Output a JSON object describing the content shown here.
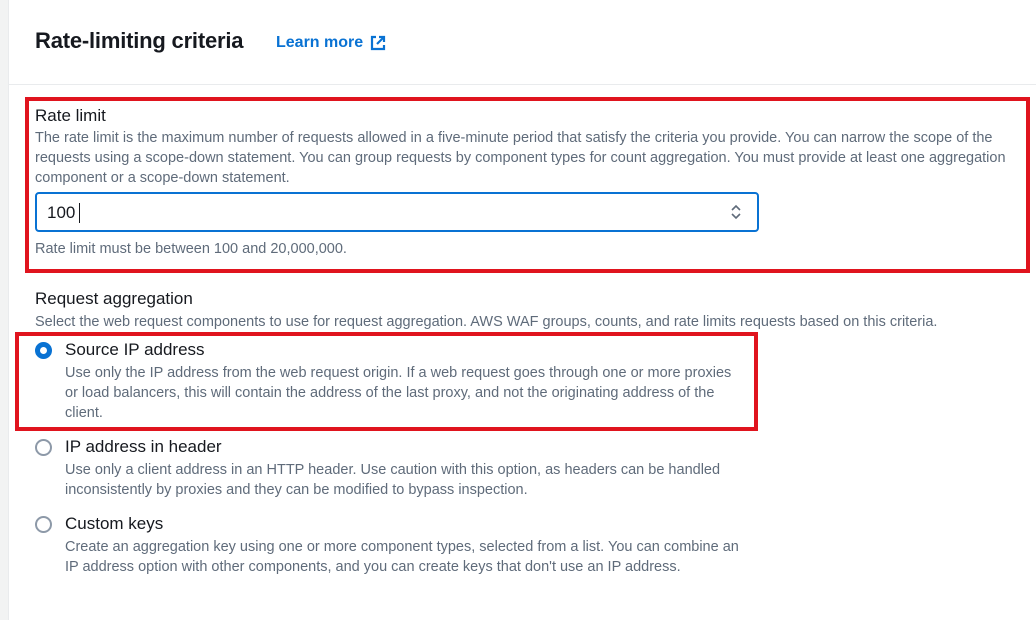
{
  "section": {
    "title": "Rate-limiting criteria",
    "learn_more": "Learn more"
  },
  "rate_limit": {
    "label": "Rate limit",
    "description": "The rate limit is the maximum number of requests allowed in a five-minute period that satisfy the criteria you provide. You can narrow the scope of the requests using a scope-down statement. You can group requests by component types for count aggregation. You must provide at least one aggregation component or a scope-down statement.",
    "value": "100",
    "constraint": "Rate limit must be between 100 and 20,000,000."
  },
  "aggregation": {
    "label": "Request aggregation",
    "description": "Select the web request components to use for request aggregation. AWS WAF groups, counts, and rate limits requests based on this criteria.",
    "options": [
      {
        "title": "Source IP address",
        "description": "Use only the IP address from the web request origin. If a web request goes through one or more proxies or load balancers, this will contain the address of the last proxy, and not the originating address of the client.",
        "selected": true
      },
      {
        "title": "IP address in header",
        "description": "Use only a client address in an HTTP header. Use caution with this option, as headers can be handled inconsistently by proxies and they can be modified to bypass inspection.",
        "selected": false
      },
      {
        "title": "Custom keys",
        "description": "Create an aggregation key using one or more component types, selected from a list. You can combine an IP address option with other components, and you can create keys that don't use an IP address.",
        "selected": false
      }
    ]
  },
  "colors": {
    "accent": "#0972d3",
    "highlight": "#e0141e",
    "muted_text": "#5f6b7a"
  },
  "icons": {
    "external_link": "external-link-icon",
    "stepper": "stepper-icon"
  }
}
